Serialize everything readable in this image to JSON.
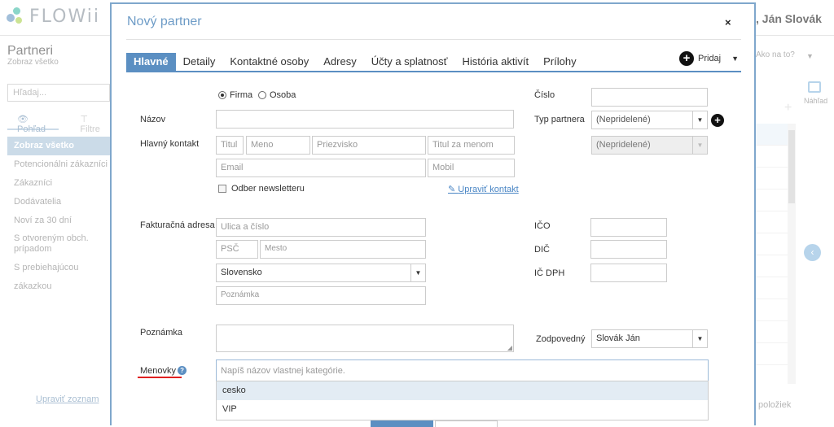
{
  "app": {
    "logo_text": "FLOWii",
    "user": ", Ján Slovák",
    "help_text": "Ako na to?",
    "preview_label": "Náhľad",
    "items_footer": "položiek",
    "colors": {
      "accent": "#5b8fc2",
      "brand": "#6e9cc7",
      "highlight": "#b8cde0"
    }
  },
  "sidebar": {
    "title": "Partneri",
    "subtitle": "Zobraz všetko",
    "search_placeholder": "Hľadaj...",
    "tab_view": "Pohľad",
    "tab_filter": "Filtre",
    "items": [
      {
        "label": "Zobraz všetko"
      },
      {
        "label": "Potencionálni zákazníci"
      },
      {
        "label": "Zákazníci"
      },
      {
        "label": "Dodávatelia"
      },
      {
        "label": "Noví za 30 dní"
      },
      {
        "label": "S otvoreným obch. prípadom"
      },
      {
        "label": "S prebiehajúcou zákazkou"
      }
    ],
    "edit_list": "Upraviť zoznam"
  },
  "modal": {
    "title": "Nový partner",
    "close_icon": "×",
    "tabs": [
      {
        "label": "Hlavné"
      },
      {
        "label": "Detaily"
      },
      {
        "label": "Kontaktné osoby"
      },
      {
        "label": "Adresy"
      },
      {
        "label": "Účty a splatnosť"
      },
      {
        "label": "História aktivít"
      },
      {
        "label": "Prílohy"
      }
    ],
    "add_label": "Pridaj",
    "form": {
      "radio_firma": "Firma",
      "radio_osoba": "Osoba",
      "label_nazov": "Názov",
      "label_hlavny_kontakt": "Hlavný kontakt",
      "ph_titul": "Titul",
      "ph_meno": "Meno",
      "ph_priezvisko": "Priezvisko",
      "ph_titul_za": "Titul za menom",
      "ph_email": "Email",
      "ph_mobil": "Mobil",
      "newsletter": "Odber newsletteru",
      "edit_contact": "Upraviť kontakt",
      "label_fakturacna": "Fakturačná adresa",
      "ph_ulica": "Ulica a číslo",
      "ph_psc": "PSČ",
      "ph_mesto": "Mesto",
      "country_value": "Slovensko",
      "ph_poznamka_addr": "Poznámka",
      "label_poznamka": "Poznámka",
      "label_menovky": "Menovky",
      "tags_placeholder": "Napíš názov vlastnej kategórie.",
      "tag_options": [
        "cesko",
        "VIP"
      ],
      "label_cislo": "Číslo",
      "label_typ": "Typ partnera",
      "typ_value": "(Nepridelené)",
      "typ2_value": "(Nepridelené)",
      "label_ico": "IČO",
      "label_dic": "DIČ",
      "label_icdph": "IČ DPH",
      "label_zodpovedny": "Zodpovedný",
      "zodpovedny_value": "Slovák Ján"
    }
  }
}
